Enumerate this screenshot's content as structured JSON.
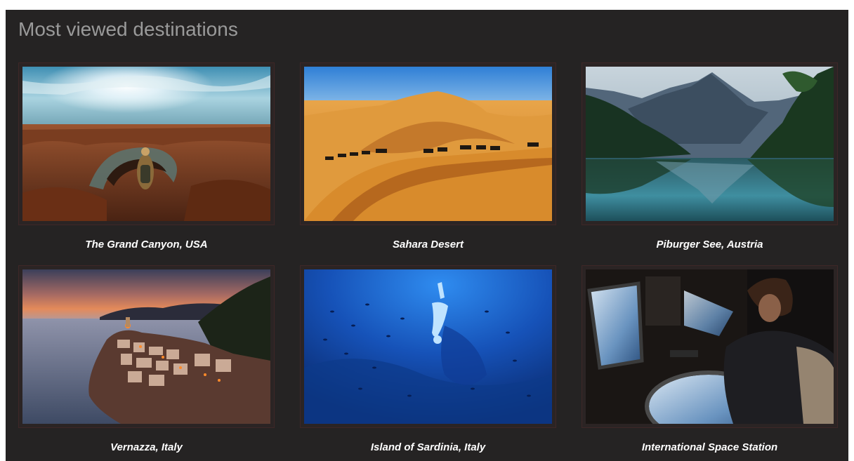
{
  "section": {
    "title": "Most viewed destinations"
  },
  "destinations": [
    {
      "name": "The Grand Canyon, USA"
    },
    {
      "name": "Sahara Desert"
    },
    {
      "name": "Piburger See, Austria"
    },
    {
      "name": "Vernazza, Italy"
    },
    {
      "name": "Island of Sardinia, Italy"
    },
    {
      "name": "International Space Station"
    }
  ],
  "colors": {
    "panel_bg": "#252323",
    "title": "#9a9a9a",
    "caption": "#ffffff",
    "frame": "#3e2727"
  }
}
